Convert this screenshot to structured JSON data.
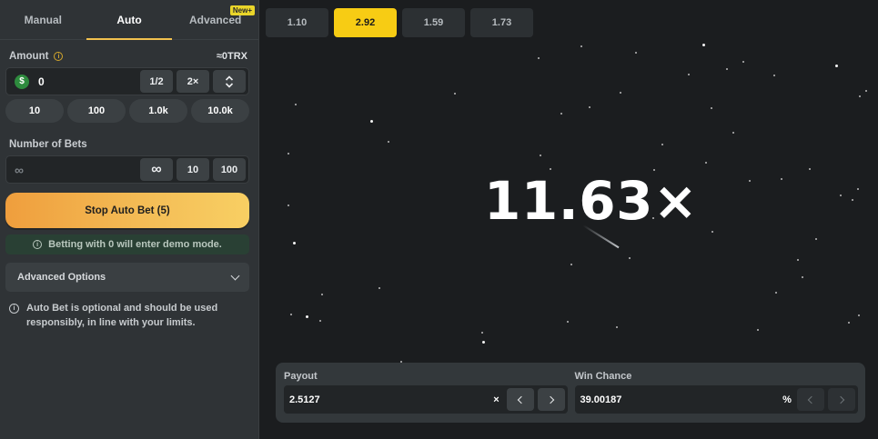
{
  "tabs": [
    {
      "label": "Manual"
    },
    {
      "label": "Auto"
    },
    {
      "label": "Advanced",
      "badge": "New+"
    }
  ],
  "amount": {
    "label": "Amount",
    "approx": "≈0TRX",
    "currency_symbol": "$",
    "value": "0",
    "half_label": "1/2",
    "double_label": "2×",
    "quick_values": [
      "10",
      "100",
      "1.0k",
      "10.0k"
    ]
  },
  "bets": {
    "label": "Number of Bets",
    "value": "∞",
    "options": [
      "∞",
      "10",
      "100"
    ]
  },
  "stop_button": "Stop Auto Bet (5)",
  "demo_notice": "Betting with 0 will enter demo mode.",
  "advanced_options": "Advanced Options",
  "auto_note": "Auto Bet is optional and should be used responsibly, in line with your limits.",
  "history": [
    {
      "value": "1.10",
      "hit": false
    },
    {
      "value": "2.92",
      "hit": true
    },
    {
      "value": "1.59",
      "hit": false
    },
    {
      "value": "1.73",
      "hit": false
    }
  ],
  "multiplier": "11.63×",
  "payout": {
    "label": "Payout",
    "value": "2.5127",
    "unit": "×"
  },
  "win_chance": {
    "label": "Win Chance",
    "value": "39.00187",
    "unit": "%"
  },
  "colors": {
    "accent": "#f7cc14",
    "stop_gradient_start": "#ef9e3d",
    "stop_gradient_end": "#f8cf63",
    "demo_bg": "#294034"
  }
}
